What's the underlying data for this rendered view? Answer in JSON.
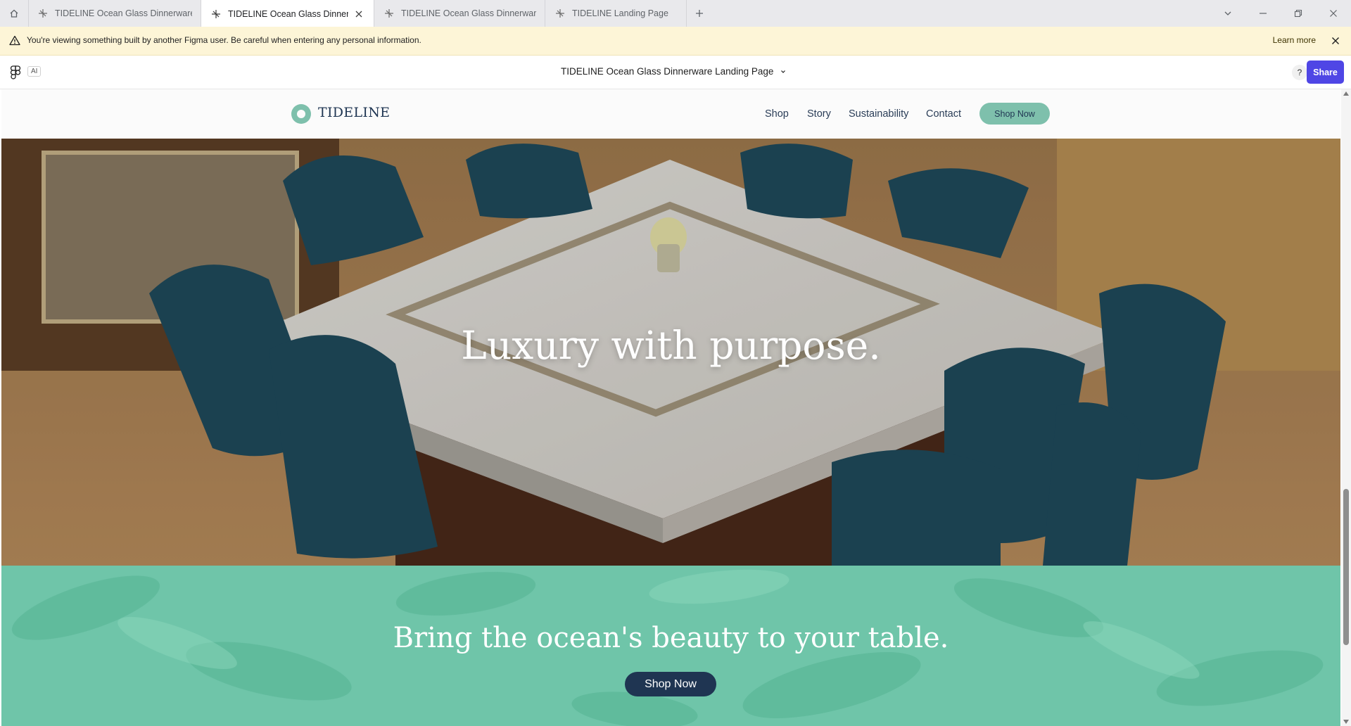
{
  "browser": {
    "tabs": [
      {
        "title": "TIDELINE Ocean Glass Dinnerware La",
        "active": false
      },
      {
        "title": "TIDELINE Ocean Glass Dinnerwa",
        "active": true
      },
      {
        "title": "TIDELINE Ocean Glass Dinnerware St",
        "active": false
      },
      {
        "title": "TIDELINE Landing Page",
        "active": false
      }
    ],
    "icons": {
      "home": "home-icon",
      "new_tab": "plus-icon",
      "tab_list": "chevron-down-icon",
      "minimize": "minimize-icon",
      "restore": "restore-icon",
      "close": "close-icon"
    }
  },
  "banner": {
    "message": "You're viewing something built by another Figma user. Be careful when entering any personal information.",
    "link": "Learn more",
    "icon": "warning-icon"
  },
  "figma_bar": {
    "ai_badge": "AI",
    "title": "TIDELINE Ocean Glass Dinnerware Landing Page",
    "help": "?",
    "share": "Share",
    "accent": "#4f46e5"
  },
  "site": {
    "brand": "TIDELINE",
    "nav": [
      "Shop",
      "Story",
      "Sustainability",
      "Contact"
    ],
    "nav_cta": "Shop Now",
    "hero_heading": "Luxury with purpose.",
    "cta_heading": "Bring the ocean's beauty to your table.",
    "cta_button": "Shop Now",
    "colors": {
      "mint": "#7ec0ac",
      "navy": "#1f3552",
      "band": "#6fc5a9"
    }
  }
}
